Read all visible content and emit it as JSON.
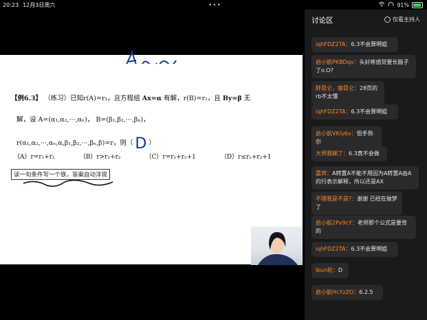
{
  "status": {
    "time": "20:23",
    "date": "12月3日周六",
    "battery": "91%",
    "battery_level": 0.91
  },
  "board": {
    "l1_a": "【例6.3】",
    "l1_b": "（练习）已知r(A)=r₁，且方程组",
    "l1_c": "Ax=α",
    "l1_d": "有解，r(B)=r₂，且",
    "l1_e": "By=β",
    "l1_f": "无",
    "l2": "解，设 A=(α₁,α₂,···,αₙ)，  B=(β₁,β₂,···,βₙ)，",
    "l3": "r(α₁,α₂,···,αₙ,α,β₁,β₂,···,βₙ,β)=r，则（",
    "answer": "D",
    "l3_end": "）",
    "options": [
      "（A）r=r₁+r₂",
      "（B）r>r₁+r₂",
      "（C）r=r₁+r₂+1",
      "（D）r≤r₁+r₂+1"
    ],
    "banner": "读一句条件写一个铁，答案自动浮现"
  },
  "panel": {
    "title": "讨论区",
    "host_only": "仅看主持人"
  },
  "messages": [
    {
      "user": "iqhFDZ2TA：",
      "text": "6.3不会算啊姐"
    },
    {
      "user": "启小航PKBDqv：",
      "text": "头好疼感觉要长脑子了o.O?"
    },
    {
      "user": "胖昆仑，瘦昆仑：",
      "text": "28页的rb不太懂"
    },
    {
      "user": "iqhFDZ2TA：",
      "text": "6.3不会算啊姐"
    },
    {
      "user": "启小航VKIy6v：",
      "text": "但手熟尔"
    },
    {
      "user": "大师我糊了：",
      "text": "6.3真不会做"
    },
    {
      "user": "嘉宾：",
      "text": "A转置A不能不用因为A转置A由A的行表示解释，所以还是AX"
    },
    {
      "user": "不理我是不是?：",
      "text": "谢谢 已经在做梦了"
    },
    {
      "user": "启小航2Pv9cY：",
      "text": "老师那个公式是要背的"
    },
    {
      "user": "iqhFDZ2TA：",
      "text": "6.3不会算啊姐"
    },
    {
      "user": "Ikun轮：",
      "text": "D"
    },
    {
      "user": "启小航HcYzZO：",
      "text": "6.2.5"
    }
  ]
}
